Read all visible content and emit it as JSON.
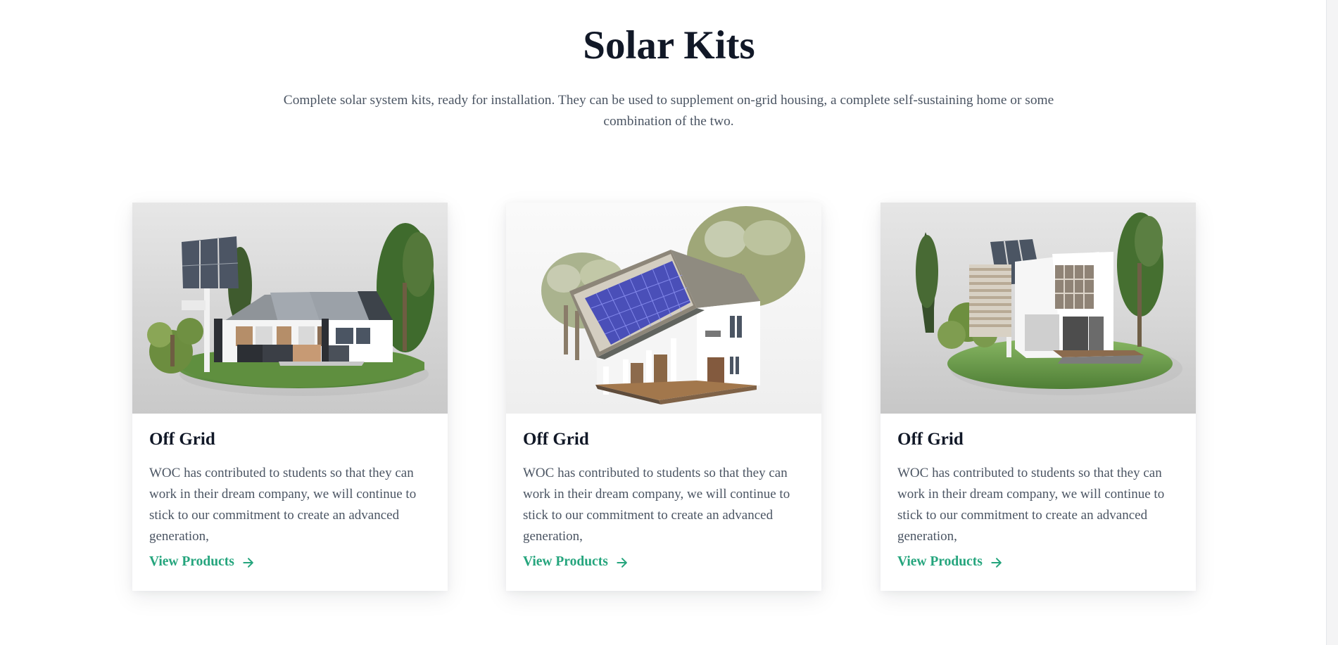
{
  "section": {
    "title": "Solar Kits",
    "subtitle": "Complete solar system kits, ready for installation. They can be used to supplement on-grid housing, a complete self-sustaining home or some combination of the two."
  },
  "cards": [
    {
      "title": "Off Grid",
      "description": "WOC has contributed to students so that they can work in their dream company, we will continue to stick to our commitment to create an advanced generation,",
      "link_label": "View Products",
      "link_icon": "arrow-right-icon"
    },
    {
      "title": "Off Grid",
      "description": "WOC has contributed to students so that they can work in their dream company, we will continue to stick to our commitment to create an advanced generation,",
      "link_label": "View Products",
      "link_icon": "arrow-right-icon"
    },
    {
      "title": "Off Grid",
      "description": "WOC has contributed to students so that they can work in their dream company, we will continue to stick to our commitment to create an advanced generation,",
      "link_label": "View Products",
      "link_icon": "arrow-right-icon"
    }
  ],
  "colors": {
    "heading": "#111827",
    "body_text": "#4b5563",
    "accent": "#25a57d"
  }
}
